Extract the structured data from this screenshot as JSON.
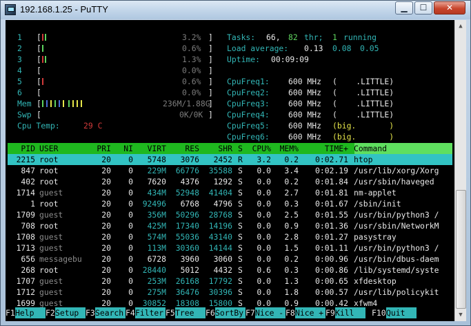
{
  "window": {
    "title": "192.168.1.25 - PuTTY",
    "min_label": "▁",
    "max_label": "☐",
    "close_label": "✕"
  },
  "cpus": [
    {
      "id": "1",
      "percent": "3.2%",
      "bars": [
        [
          "#d23a3a",
          1
        ],
        [
          "#5fd35f",
          1
        ]
      ]
    },
    {
      "id": "2",
      "percent": "0.6%",
      "bars": [
        [
          "#5fd35f",
          1
        ]
      ]
    },
    {
      "id": "3",
      "percent": "1.3%",
      "bars": [
        [
          "#d23a3a",
          1
        ],
        [
          "#5fd35f",
          1
        ]
      ]
    },
    {
      "id": "4",
      "percent": "0.0%",
      "bars": []
    },
    {
      "id": "5",
      "percent": "0.6%",
      "bars": [
        [
          "#d23a3a",
          1
        ]
      ]
    },
    {
      "id": "6",
      "percent": "0.0%",
      "bars": []
    }
  ],
  "mem": {
    "label": "Mem",
    "value": "236M/1.88G",
    "bars": [
      "#5fd35f",
      "#4a6fd9",
      "#e6e64a",
      "#5fd35f",
      "#4a6fd9",
      "#e6e64a",
      "#5fd35f",
      "#e6e64a",
      "#e6e64a",
      "#e6e64a"
    ]
  },
  "swp": {
    "label": "Swp",
    "value": "0K/0K"
  },
  "cpu_temp": {
    "label": "Cpu Temp:",
    "value": "29 C"
  },
  "stats": {
    "tasks_label": "Tasks:",
    "tasks": "66,",
    "threads": "82",
    "thr_label": "thr;",
    "running": "1",
    "running_label": "running",
    "load_label": "Load average:",
    "load1": "0.13",
    "load5": "0.08",
    "load15": "0.05",
    "uptime_label": "Uptime:",
    "uptime": "00:09:09"
  },
  "freqs": [
    {
      "label": "CpuFreq1:",
      "value": "600 MHz",
      "core": "(    .LITTLE)",
      "big": false
    },
    {
      "label": "CpuFreq2:",
      "value": "600 MHz",
      "core": "(    .LITTLE)",
      "big": false
    },
    {
      "label": "CpuFreq3:",
      "value": "600 MHz",
      "core": "(    .LITTLE)",
      "big": false
    },
    {
      "label": "CpuFreq4:",
      "value": "600 MHz",
      "core": "(    .LITTLE)",
      "big": false
    },
    {
      "label": "CpuFreq5:",
      "value": "600 MHz",
      "core": "(big.       )",
      "big": true
    },
    {
      "label": "CpuFreq6:",
      "value": "600 MHz",
      "core": "(big.       )",
      "big": true
    }
  ],
  "table": {
    "headers": [
      "PID",
      "USER",
      "PRI",
      "NI",
      "VIRT",
      "RES",
      "SHR",
      "S",
      "CPU%",
      "MEM%",
      "TIME+",
      "Command"
    ],
    "rows": [
      [
        "2215",
        "root",
        "20",
        "0",
        "5748",
        "3076",
        "2452",
        "R",
        "3.2",
        "0.2",
        "0:02.71",
        "htop"
      ],
      [
        "847",
        "root",
        "20",
        "0",
        "229M",
        "66776",
        "35588",
        "S",
        "0.0",
        "3.4",
        "0:02.19",
        "/usr/lib/xorg/Xorg"
      ],
      [
        "402",
        "root",
        "20",
        "0",
        "7620",
        "4376",
        "1292",
        "S",
        "0.0",
        "0.2",
        "0:01.84",
        "/usr/sbin/haveged"
      ],
      [
        "1714",
        "guest",
        "20",
        "0",
        "434M",
        "52948",
        "41404",
        "S",
        "0.0",
        "2.7",
        "0:01.81",
        "nm-applet"
      ],
      [
        "1",
        "root",
        "20",
        "0",
        "92496",
        "6768",
        "4796",
        "S",
        "0.0",
        "0.3",
        "0:01.67",
        "/sbin/init"
      ],
      [
        "1709",
        "guest",
        "20",
        "0",
        "356M",
        "50296",
        "28768",
        "S",
        "0.0",
        "2.5",
        "0:01.55",
        "/usr/bin/python3 /"
      ],
      [
        "708",
        "root",
        "20",
        "0",
        "425M",
        "17340",
        "14196",
        "S",
        "0.0",
        "0.9",
        "0:01.36",
        "/usr/sbin/NetworkM"
      ],
      [
        "1708",
        "guest",
        "20",
        "0",
        "574M",
        "55036",
        "43140",
        "S",
        "0.0",
        "2.8",
        "0:01.27",
        "pasystray"
      ],
      [
        "1713",
        "guest",
        "20",
        "0",
        "113M",
        "30360",
        "14144",
        "S",
        "0.0",
        "1.5",
        "0:01.11",
        "/usr/bin/python3 /"
      ],
      [
        "656",
        "messagebu",
        "20",
        "0",
        "6728",
        "3960",
        "3060",
        "S",
        "0.0",
        "0.2",
        "0:00.96",
        "/usr/bin/dbus-daem"
      ],
      [
        "268",
        "root",
        "20",
        "0",
        "28440",
        "5012",
        "4432",
        "S",
        "0.6",
        "0.3",
        "0:00.86",
        "/lib/systemd/syste"
      ],
      [
        "1707",
        "guest",
        "20",
        "0",
        "253M",
        "26168",
        "17792",
        "S",
        "0.0",
        "1.3",
        "0:00.65",
        "xfdesktop"
      ],
      [
        "1712",
        "guest",
        "20",
        "0",
        "275M",
        "36476",
        "30396",
        "S",
        "0.0",
        "1.8",
        "0:00.57",
        "/usr/lib/policykit"
      ],
      [
        "1699",
        "guest",
        "20",
        "0",
        "30852",
        "18308",
        "15800",
        "S",
        "0.0",
        "0.9",
        "0:00.42",
        "xfwm4"
      ]
    ]
  },
  "fkeys": [
    {
      "key": "F1",
      "label": "Help  "
    },
    {
      "key": "F2",
      "label": "Setup "
    },
    {
      "key": "F3",
      "label": "Search"
    },
    {
      "key": "F4",
      "label": "Filter"
    },
    {
      "key": "F5",
      "label": "Tree  "
    },
    {
      "key": "F6",
      "label": "SortBy"
    },
    {
      "key": "F7",
      "label": "Nice -"
    },
    {
      "key": "F8",
      "label": "Nice +"
    },
    {
      "key": "F9",
      "label": "Kill  "
    },
    {
      "key": "F10",
      "label": "Quit  "
    }
  ]
}
